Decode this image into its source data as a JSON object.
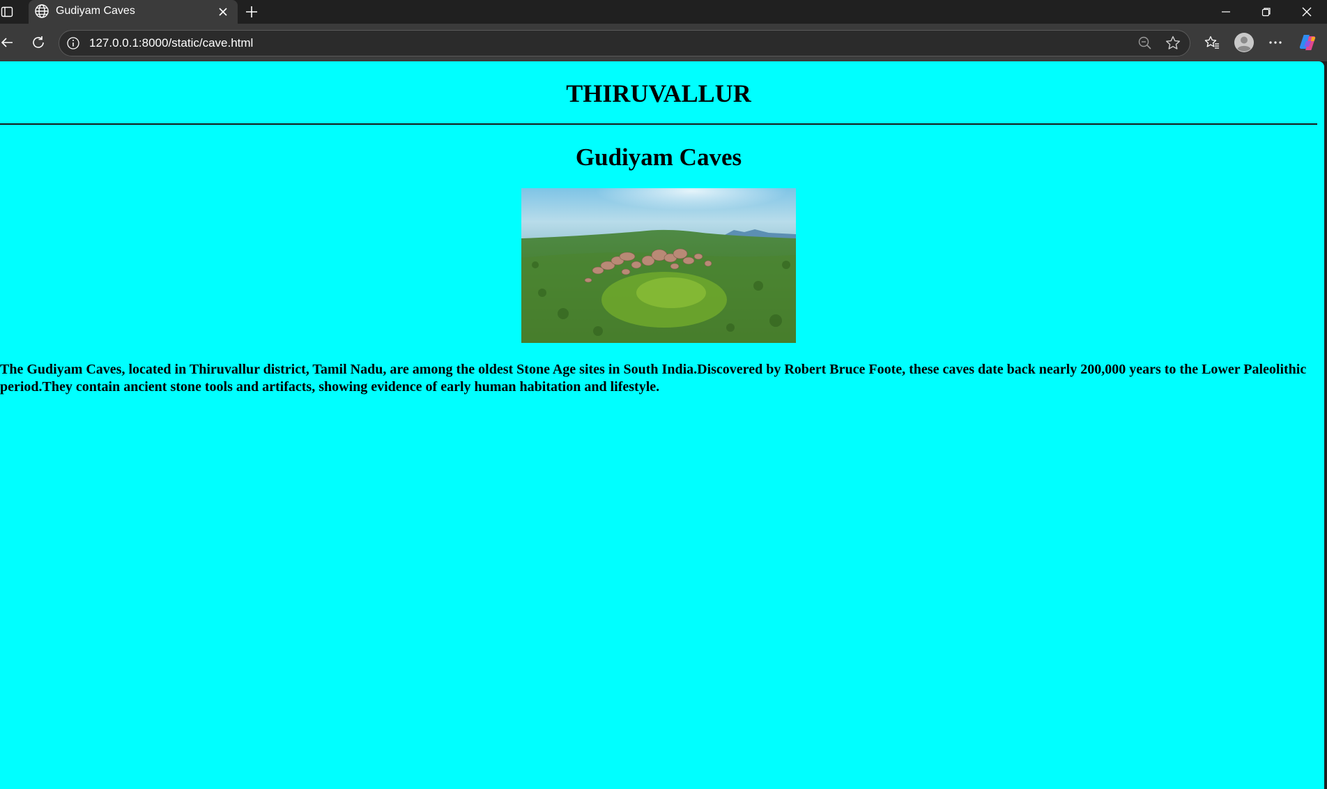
{
  "browser": {
    "tab_title": "Gudiyam Caves",
    "url": "127.0.0.1:8000/static/cave.html"
  },
  "page": {
    "heading": "THIRUVALLUR",
    "subheading": "Gudiyam Caves",
    "description": "The Gudiyam Caves, located in Thiruvallur district, Tamil Nadu, are among the oldest Stone Age sites in South India.Discovered by Robert Bruce Foote, these caves date back nearly 200,000 years to the Lower Paleolithic period.They contain ancient stone tools and artifacts, showing evidence of early human habitation and lifestyle."
  },
  "colors": {
    "page_background": "#00ffff",
    "text": "#000000",
    "browser_chrome": "#202020",
    "toolbar": "#3b3b3b"
  },
  "icons": [
    "sidebar-toggle-icon",
    "globe-icon",
    "close-icon",
    "plus-icon",
    "minimize-icon",
    "restore-icon",
    "back-icon",
    "reload-icon",
    "info-icon",
    "zoom-out-icon",
    "star-icon",
    "favorites-icon",
    "profile-icon",
    "more-icon",
    "copilot-icon"
  ]
}
